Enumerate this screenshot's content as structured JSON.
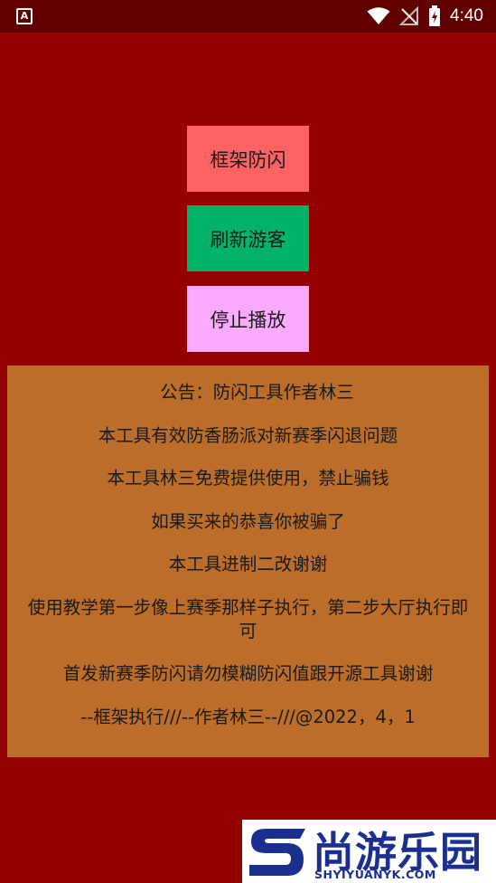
{
  "status_bar": {
    "time": "4:40",
    "left_icon_glyph": "A",
    "icons": [
      "app-notification-icon",
      "wifi-icon",
      "no-signal-icon",
      "battery-charging-icon"
    ]
  },
  "buttons": {
    "frame": "框架防闪",
    "refresh": "刷新游客",
    "stop": "停止播放"
  },
  "notice": {
    "lines": [
      "公告：防闪工具作者林三",
      "本工具有效防香肠派对新赛季闪退问题",
      "本工具林三免费提供使用，禁止骗钱",
      "如果买来的恭喜你被骗了",
      "本工具进制二改谢谢",
      "使用教学第一步像上赛季那样子执行，第二步大厅执行即可",
      "首发新赛季防闪请勿模糊防闪值跟开源工具谢谢",
      "--框架执行///--作者林三--///@2022，4，1"
    ]
  },
  "watermark": {
    "title": "尚游乐园",
    "url": "SHYIYUANYK.COM"
  },
  "colors": {
    "background": "#950000",
    "status_bar": "#620000",
    "frame_button": "#fe6363",
    "refresh_button": "#00b368",
    "stop_button": "#fcaafe",
    "notice_panel": "#bb6d29",
    "watermark_blue": "#1b2f8e"
  }
}
